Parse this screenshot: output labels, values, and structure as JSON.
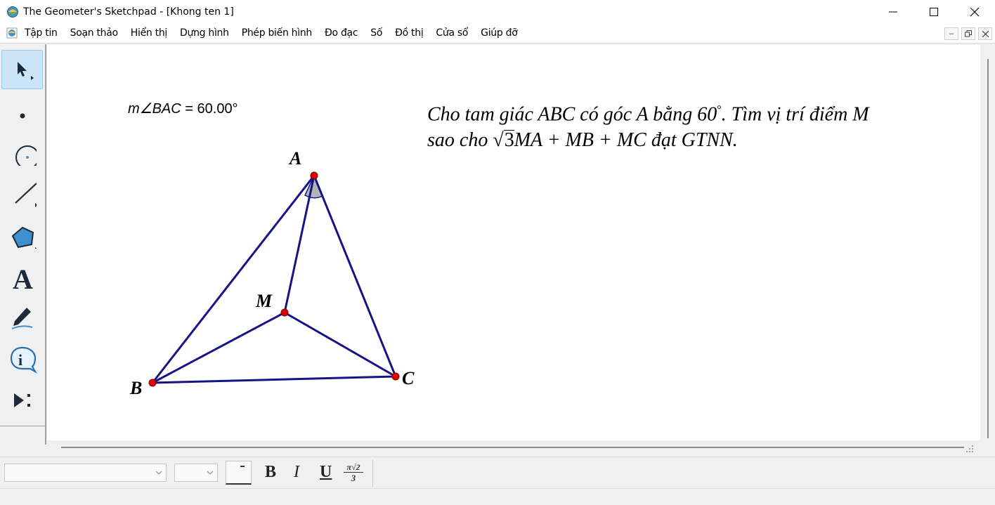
{
  "window": {
    "title": "The Geometer's Sketchpad - [Khong ten 1]"
  },
  "menu": {
    "items": [
      {
        "label": "Tập tin",
        "name": "menu-file"
      },
      {
        "label": "Soạn thảo",
        "name": "menu-edit"
      },
      {
        "label": "Hiển thị",
        "name": "menu-display"
      },
      {
        "label": "Dựng hình",
        "name": "menu-construct"
      },
      {
        "label": "Phép biến hình",
        "name": "menu-transform"
      },
      {
        "label": "Đo đạc",
        "name": "menu-measure"
      },
      {
        "label": "Số",
        "name": "menu-number"
      },
      {
        "label": "Đồ thị",
        "name": "menu-graph"
      },
      {
        "label": "Cửa sổ",
        "name": "menu-window"
      },
      {
        "label": "Giúp đỡ",
        "name": "menu-help"
      }
    ]
  },
  "toolbox": {
    "tools": [
      "arrow-select-tool",
      "point-tool",
      "compass-tool",
      "straightedge-tool",
      "polygon-tool",
      "text-tool",
      "marker-tool",
      "information-tool",
      "custom-tool"
    ]
  },
  "sketch": {
    "measurement": {
      "prefix": "m∠",
      "angle": "BAC",
      "value": " = 60.00°"
    },
    "problem": {
      "line1": "Cho tam giác ABC có góc A bằng 60",
      "degree": "°",
      "line1_end": ". Tìm vị trí điểm M",
      "line2_start": "sao cho ",
      "sqrt_sign": "√",
      "sqrt_arg": "3",
      "line2_end": "MA + MB + MC đạt GTNN."
    },
    "points": {
      "A": "A",
      "B": "B",
      "C": "C",
      "M": "M"
    },
    "colors": {
      "segment": "#141487",
      "point": "#e00000",
      "angle_mark": "#b4b4b4"
    }
  },
  "format": {
    "bold": "B",
    "italic": "I",
    "underline": "U",
    "math_top": "π√2",
    "math_bottom": "3"
  }
}
